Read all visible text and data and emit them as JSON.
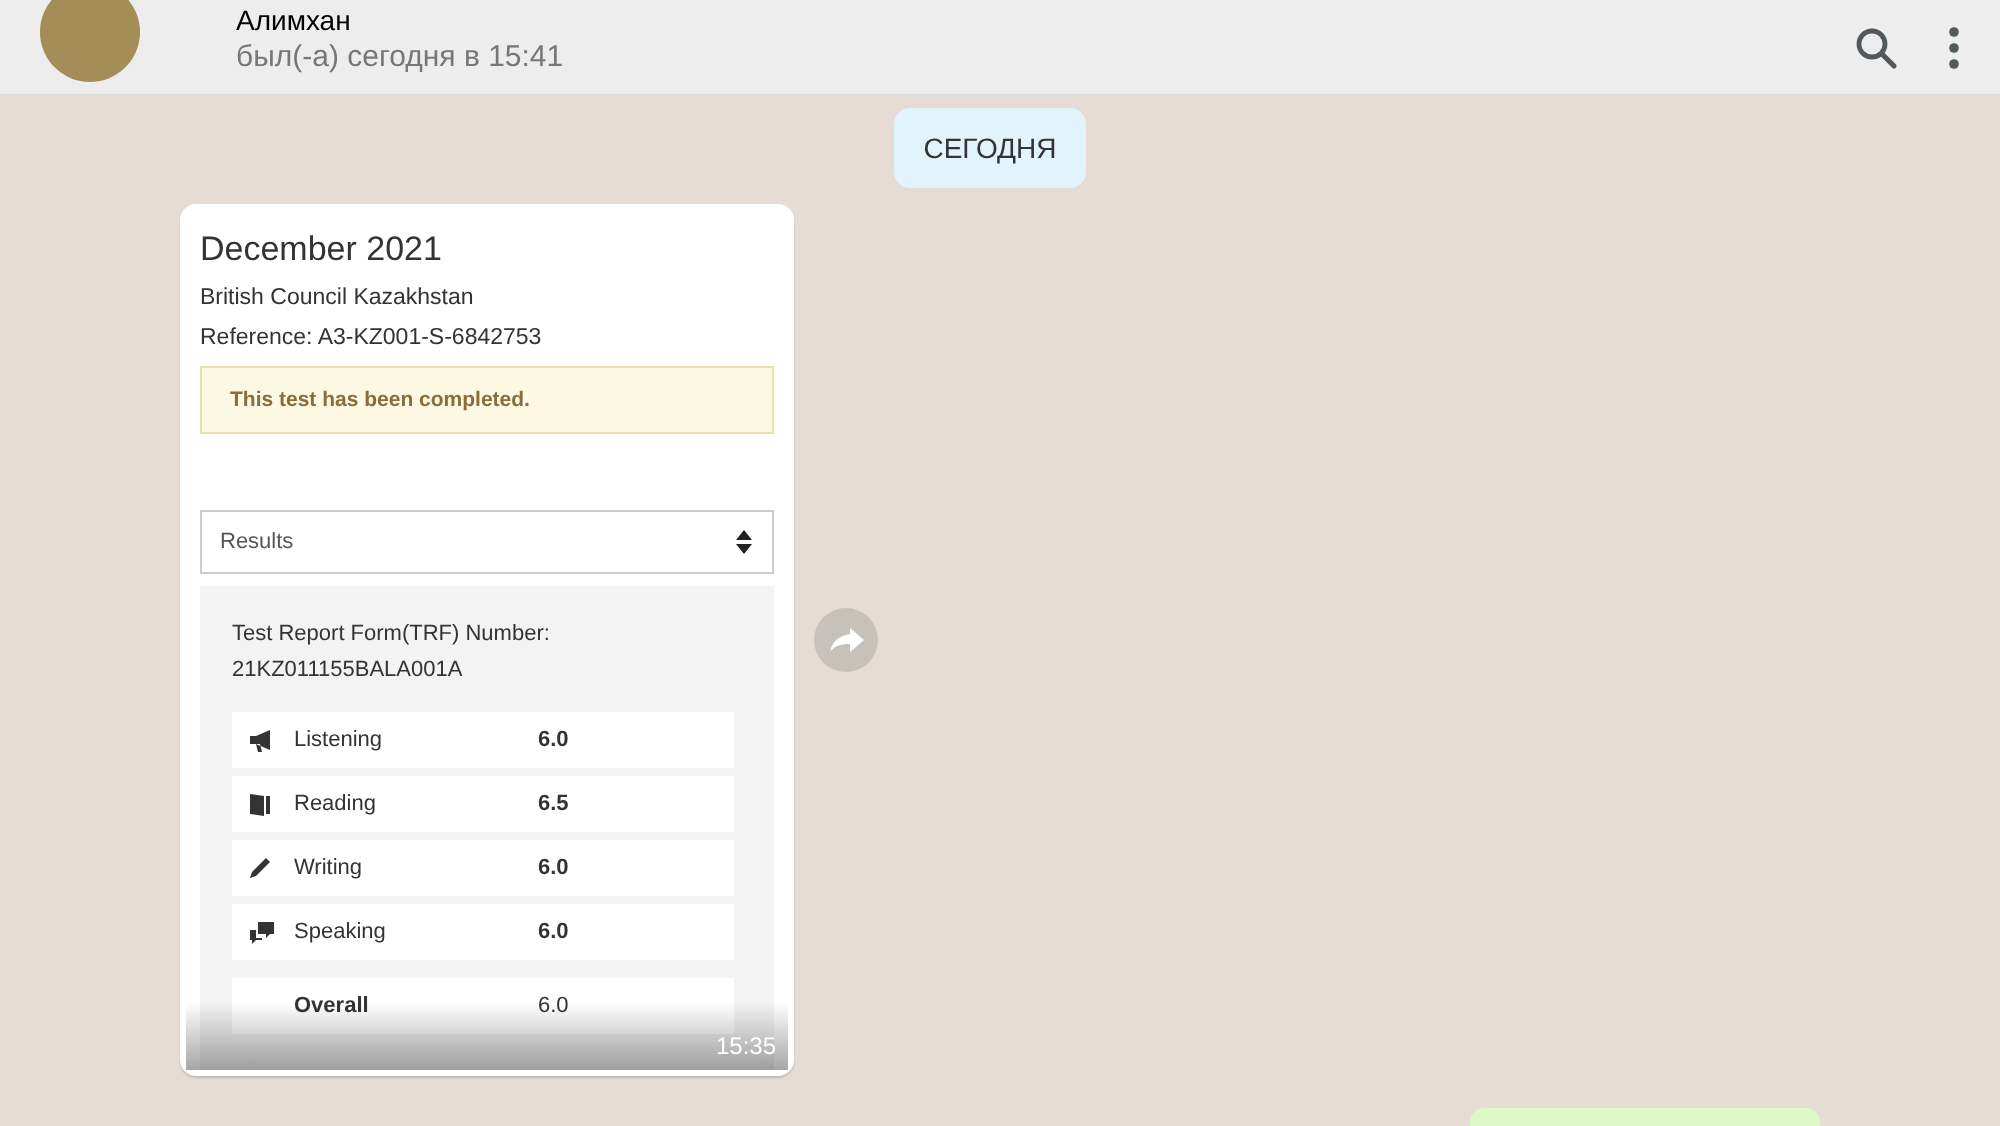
{
  "contact": {
    "name": "Алимхан",
    "last_seen": "был(-а) сегодня в 15:41"
  },
  "date_chip": "СЕГОДНЯ",
  "message": {
    "time": "15:35",
    "document": {
      "title": "December 2021",
      "centre": "British Council Kazakhstan",
      "reference": "Reference: A3-KZ001-S-6842753",
      "notice": "This test has been completed.",
      "select": {
        "value": "Results"
      },
      "trf_label": "Test Report Form(TRF) Number:",
      "trf_number": "21KZ011155BALA001A",
      "scores": [
        {
          "kind": "listening",
          "skill": "Listening",
          "score": "6.0"
        },
        {
          "kind": "reading",
          "skill": "Reading",
          "score": "6.5"
        },
        {
          "kind": "writing",
          "skill": "Writing",
          "score": "6.0"
        },
        {
          "kind": "speaking",
          "skill": "Speaking",
          "score": "6.0"
        },
        {
          "kind": "overall",
          "skill": "Overall",
          "score": "6.0"
        }
      ]
    }
  }
}
